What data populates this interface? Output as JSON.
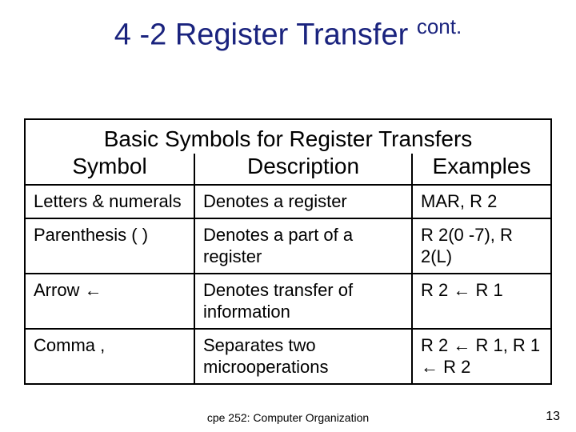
{
  "title": {
    "main": "4 -2 Register Transfer ",
    "sup": "cont."
  },
  "table": {
    "caption": "Basic Symbols for Register Transfers",
    "headers": {
      "symbol": "Symbol",
      "description": "Description",
      "examples": "Examples"
    },
    "rows": [
      {
        "symbol": "Letters & numerals",
        "description": "Denotes a register",
        "examples": "MAR, R 2"
      },
      {
        "symbol": "Parenthesis (  )",
        "description": "Denotes a part of a register",
        "examples": "R 2(0 -7), R 2(L)"
      },
      {
        "symbol": "Arrow ←",
        "description": "Denotes transfer of information",
        "examples": "R 2 ← R 1"
      },
      {
        "symbol": "Comma ,",
        "description": "Separates two microoperations",
        "examples": "R 2 ← R 1, R 1 ← R 2"
      }
    ]
  },
  "footer": "cpe 252: Computer Organization",
  "page": "13"
}
